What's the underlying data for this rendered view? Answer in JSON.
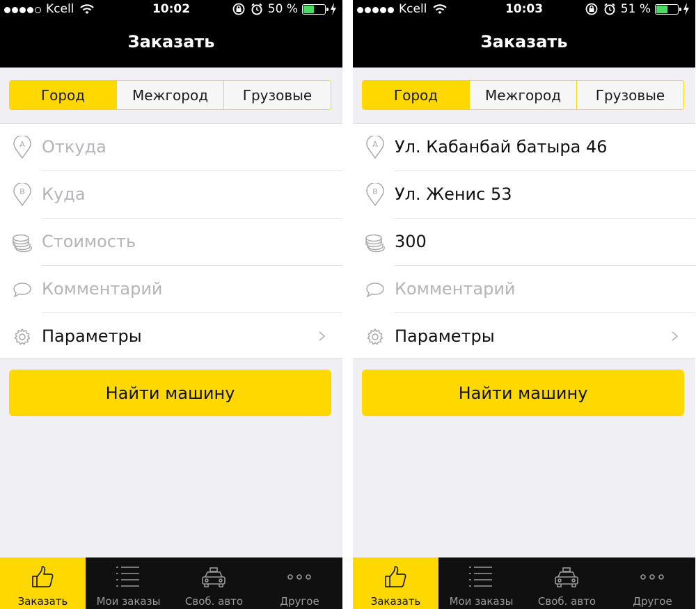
{
  "screens": [
    {
      "status": {
        "carrier": "Kcell",
        "time": "10:02",
        "battery": "50 %",
        "battery_level": 0.5
      },
      "title": "Заказать",
      "segments": [
        "Город",
        "Межгород",
        "Грузовые"
      ],
      "active_segment": "Город",
      "fields": {
        "from": "Откуда",
        "to": "Куда",
        "cost": "Стоимость",
        "comment": "Комментарий",
        "params": "Параметры"
      },
      "button": "Найти машину",
      "tabs": [
        "Заказать",
        "Мои заказы",
        "Своб. авто",
        "Другое"
      ],
      "active_tab": "Заказать"
    },
    {
      "status": {
        "carrier": "Kcell",
        "time": "10:03",
        "battery": "51 %",
        "battery_level": 0.51
      },
      "title": "Заказать",
      "segments": [
        "Город",
        "Межгород",
        "Грузовые"
      ],
      "active_segment": "Город",
      "fields": {
        "from": "Ул. Кабанбай батыра 46",
        "to": "Ул. Женис 53",
        "cost": "300",
        "comment": "Комментарий",
        "params": "Параметры"
      },
      "button": "Найти машину",
      "tabs": [
        "Заказать",
        "Мои заказы",
        "Своб. авто",
        "Другое"
      ],
      "active_tab": "Заказать"
    }
  ],
  "colors": {
    "accent": "#ffd800",
    "header": "#000000",
    "tabbar": "#101010",
    "placeholder": "#b4b4b9",
    "background": "#efeff4"
  }
}
